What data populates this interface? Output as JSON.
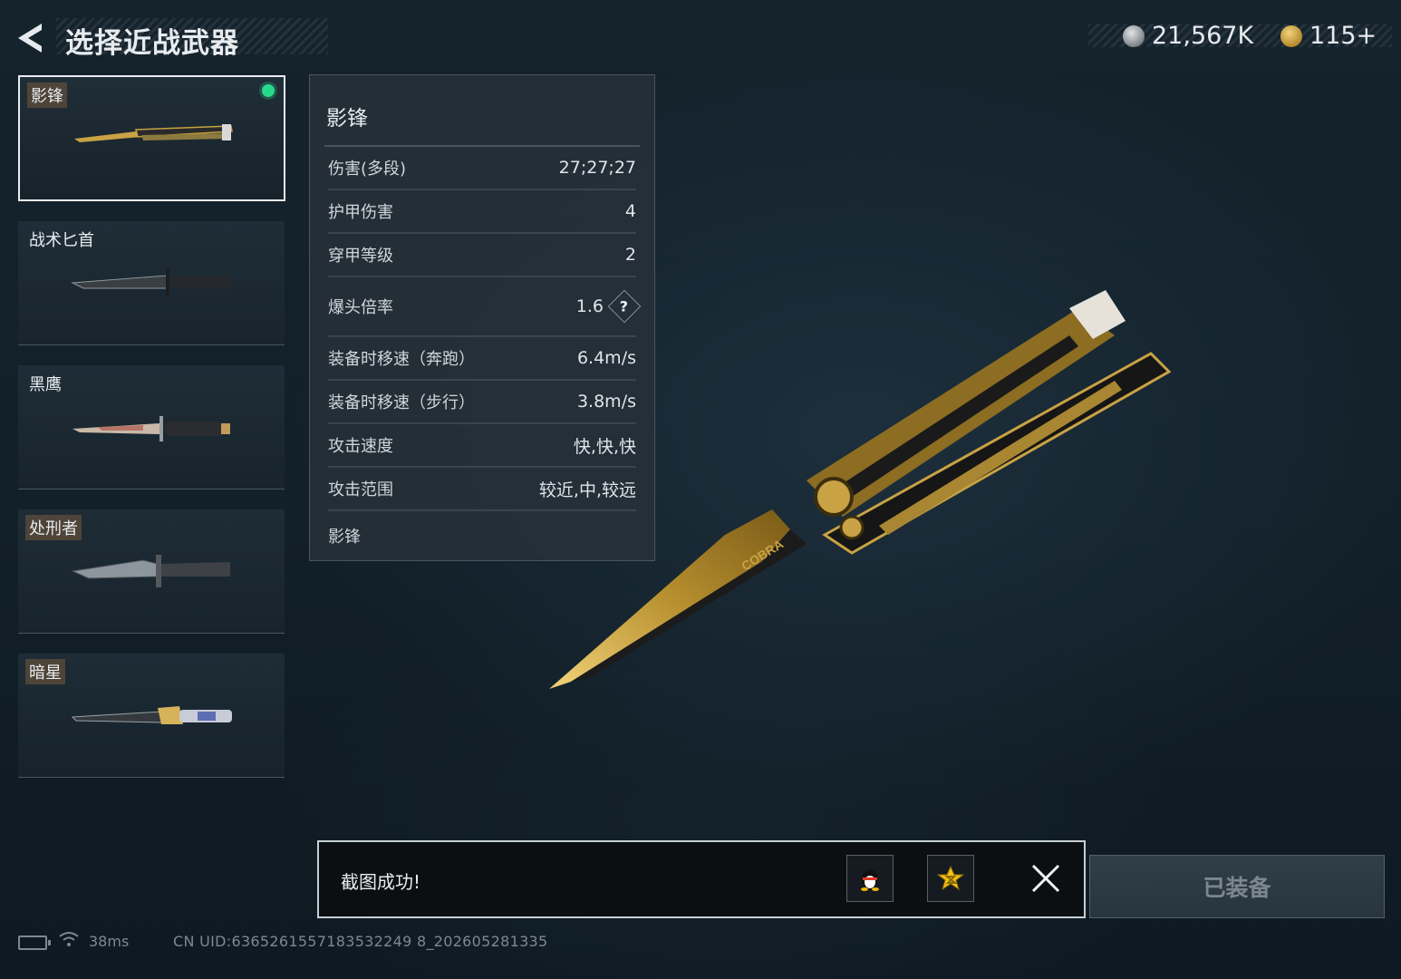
{
  "header": {
    "title": "选择近战武器",
    "silver_amount": "21,567K",
    "gold_amount": "115+"
  },
  "weapons": [
    {
      "name": "影锋",
      "tag_style": true,
      "equipped": true
    },
    {
      "name": "战术匕首",
      "tag_style": false,
      "equipped": false
    },
    {
      "name": "黑鹰",
      "tag_style": false,
      "equipped": false
    },
    {
      "name": "处刑者",
      "tag_style": true,
      "equipped": false
    },
    {
      "name": "暗星",
      "tag_style": true,
      "equipped": false
    }
  ],
  "stats_panel": {
    "title": "影锋",
    "rows": [
      {
        "label": "伤害(多段)",
        "value": "27;27;27"
      },
      {
        "label": "护甲伤害",
        "value": "4"
      },
      {
        "label": "穿甲等级",
        "value": "2"
      },
      {
        "label": "爆头倍率",
        "value": "1.6"
      },
      {
        "label": "装备时移速（奔跑）",
        "value": "6.4m/s"
      },
      {
        "label": "装备时移速（步行）",
        "value": "3.8m/s"
      },
      {
        "label": "攻击速度",
        "value": "快,快,快"
      },
      {
        "label": "攻击范围",
        "value": "较近,中,较远"
      }
    ],
    "help_glyph": "?",
    "footer": "影锋"
  },
  "knife_art": {
    "brand_text": "COBRA"
  },
  "toast": {
    "message": "截图成功!",
    "share_qq_icon": "qq-penguin-icon",
    "share_qzone_icon": "qzone-star-icon",
    "close_icon": "close-icon"
  },
  "equip_button": {
    "label": "已装备"
  },
  "status": {
    "ping": "38ms",
    "uid": "CN UID:6365261557183532249 8_202605281335"
  },
  "colors": {
    "equipped_dot": "#29d98a",
    "gold_accent": "#c8a244",
    "panel_bg": "#262f37"
  }
}
